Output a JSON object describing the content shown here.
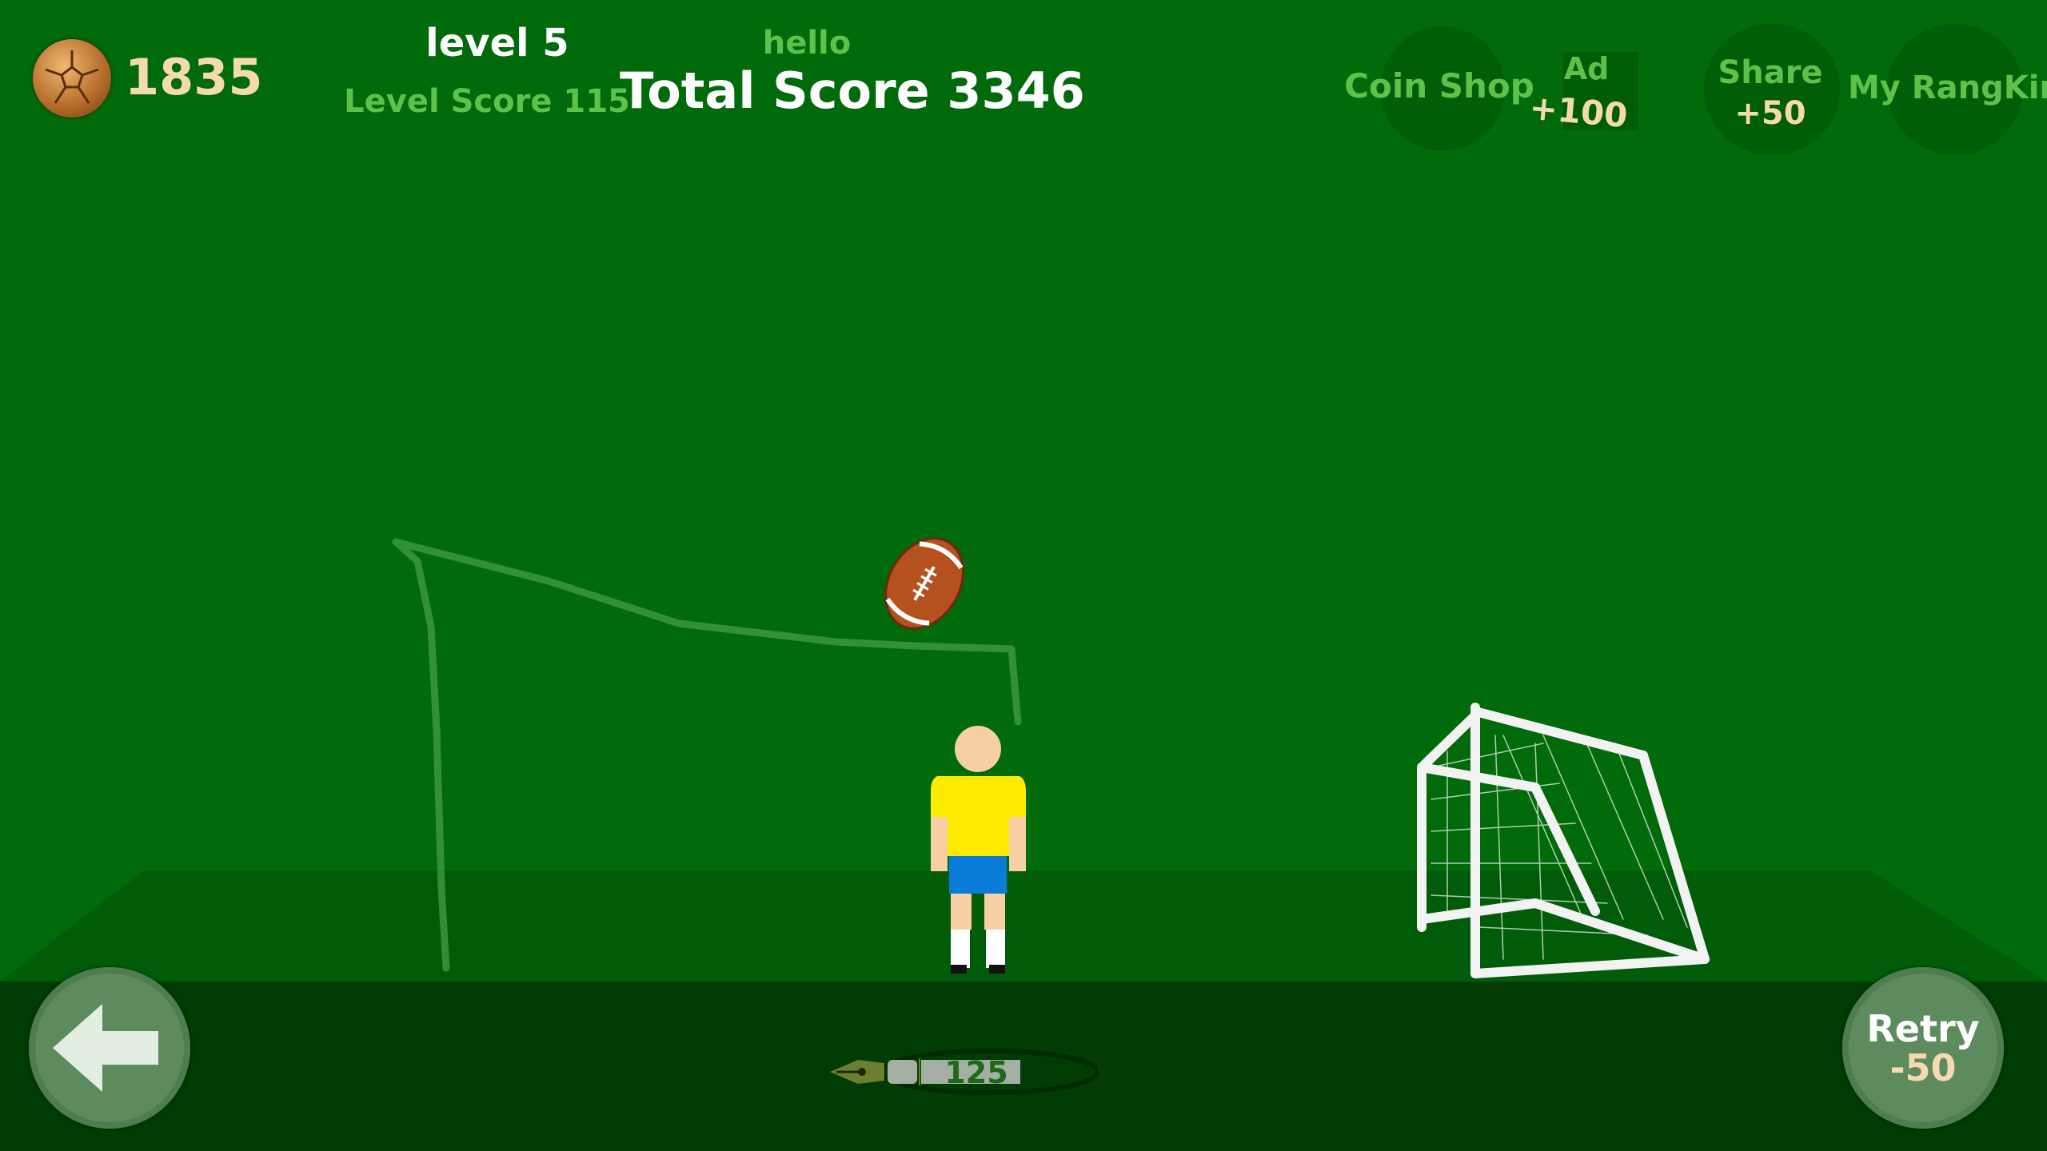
{
  "hud": {
    "coins": "1835",
    "level": "level 5",
    "level_score": "Level Score 115",
    "greeting": "hello",
    "total_score": "Total Score 3346"
  },
  "top_buttons": {
    "coin_shop": "Coin Shop",
    "ad_label": "Ad",
    "ad_reward": "+100",
    "share_label": "Share",
    "share_reward": "+50",
    "ranking": "My RangKing"
  },
  "bottom": {
    "ink_remaining": "125",
    "retry_label": "Retry",
    "retry_cost": "-50"
  },
  "icons": {
    "coin": "soccer-ball-coin-icon",
    "back": "arrow-left-icon",
    "ink": "fountain-pen-icon",
    "ad": "video-icon"
  },
  "colors": {
    "sky": "#016a0b",
    "field": "#015c09",
    "ground": "#003c04",
    "accent_green": "#5dc24a",
    "cream": "#f5d9b0",
    "shirt": "#ffeb00",
    "shorts": "#0a7bd6"
  }
}
